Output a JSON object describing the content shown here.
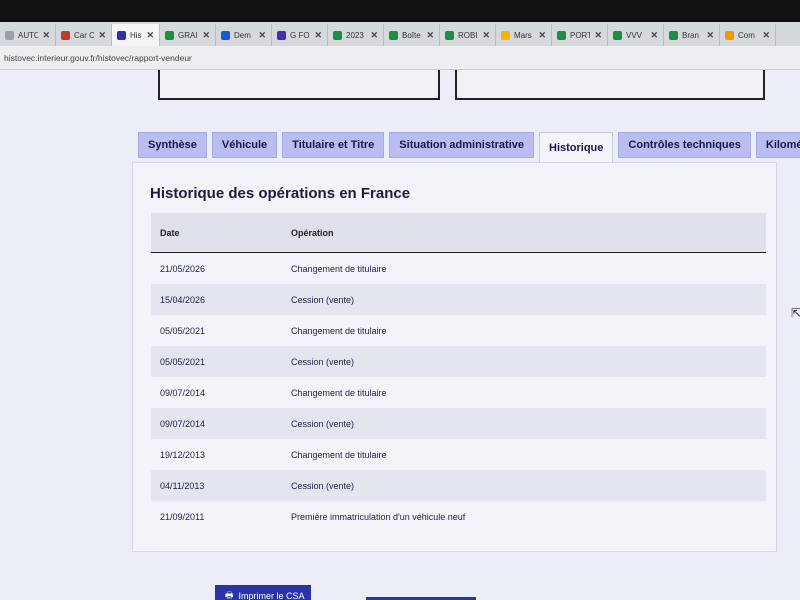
{
  "browser": {
    "tabs": [
      {
        "label": "AUTO",
        "color": "#9aa0a6"
      },
      {
        "label": "Car Cr",
        "color": "#c0392b"
      },
      {
        "label": "Histo",
        "color": "#2a34a8",
        "active": true
      },
      {
        "label": "GRAI",
        "color": "#1e8e3e"
      },
      {
        "label": "Dem",
        "color": "#1a56db"
      },
      {
        "label": "G FO",
        "color": "#4a2bb5"
      },
      {
        "label": "2023",
        "color": "#1e8e3e"
      },
      {
        "label": "Boîte",
        "color": "#1e8e3e"
      },
      {
        "label": "ROBI",
        "color": "#1e8e3e"
      },
      {
        "label": "Mars",
        "color": "#f4b400"
      },
      {
        "label": "PORT",
        "color": "#1e8e3e"
      },
      {
        "label": "VVV",
        "color": "#1e8e3e"
      },
      {
        "label": "Bran",
        "color": "#1e8e3e"
      },
      {
        "label": "Com",
        "color": "#f29900"
      }
    ],
    "close_glyph": "✕",
    "url": "histovec.interieur.gouv.fr/histovec/rapport-vendeur"
  },
  "nav_tabs": [
    {
      "label": "Synthèse"
    },
    {
      "label": "Véhicule"
    },
    {
      "label": "Titulaire et Titre"
    },
    {
      "label": "Situation administrative"
    },
    {
      "label": "Historique",
      "active": true
    },
    {
      "label": "Contrôles techniques"
    },
    {
      "label": "Kilométrage"
    }
  ],
  "history": {
    "title": "Historique des opérations en France",
    "columns": {
      "date": "Date",
      "operation": "Opération"
    },
    "rows": [
      {
        "date": "21/05/2026",
        "operation": "Changement de titulaire"
      },
      {
        "date": "15/04/2026",
        "operation": "Cession (vente)"
      },
      {
        "date": "05/05/2021",
        "operation": "Changement de titulaire"
      },
      {
        "date": "05/05/2021",
        "operation": "Cession (vente)"
      },
      {
        "date": "09/07/2014",
        "operation": "Changement de titulaire"
      },
      {
        "date": "09/07/2014",
        "operation": "Cession (vente)"
      },
      {
        "date": "19/12/2013",
        "operation": "Changement de titulaire"
      },
      {
        "date": "04/11/2013",
        "operation": "Cession (vente)"
      },
      {
        "date": "21/09/2011",
        "operation": "Première immatriculation d'un véhicule neuf"
      }
    ]
  },
  "footer": {
    "print_label": "Imprimer le CSA",
    "print_icon": "printer-icon"
  },
  "colors": {
    "accent": "#2a34a8",
    "tab_bg": "#b9bdf2"
  }
}
